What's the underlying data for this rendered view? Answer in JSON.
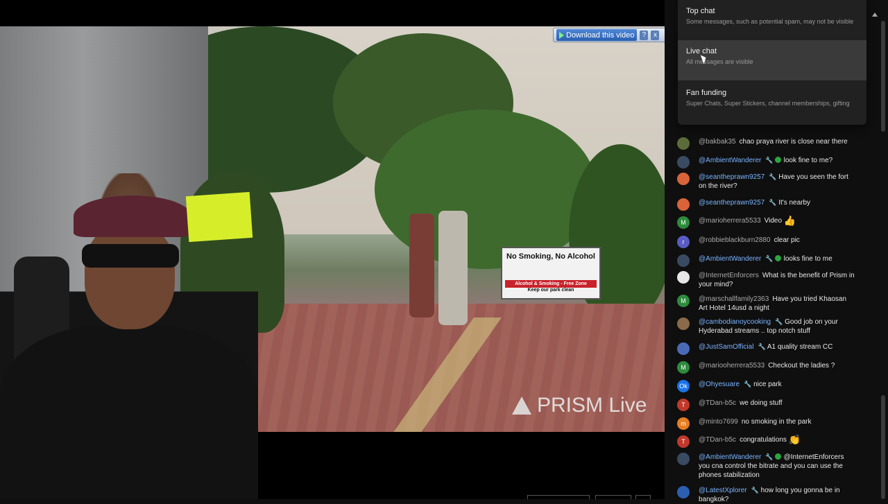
{
  "video": {
    "download_label": "Download this video",
    "help_label": "?",
    "close_label": "x",
    "sign_title": "No Smoking, No Alcohol",
    "sign_subtitle": "Alcohol & Smoking - Free Zone",
    "sign_footer": "Keep our park clean",
    "watermark": "PRISM Live"
  },
  "chat_menu": {
    "items": [
      {
        "title": "Top chat",
        "subtitle": "Some messages, such as potential spam, may not be visible"
      },
      {
        "title": "Live chat",
        "subtitle": "All messages are visible"
      },
      {
        "title": "Fan funding",
        "subtitle": "Super Chats, Super Stickers, channel memberships, gifting"
      }
    ]
  },
  "chat": {
    "messages": [
      {
        "author": "@bakbak35",
        "text": "chao praya river is close near there",
        "avatar": "",
        "avatar_color": "#5c6b3a",
        "member": false
      },
      {
        "author": "@AmbientWanderer",
        "text": "look fine to me?",
        "avatar": "",
        "avatar_color": "#394b63",
        "member": true,
        "verified": true
      },
      {
        "author": "@seantheprawn9257",
        "text": "Have you seen the fort on the river?",
        "avatar": "",
        "avatar_color": "#d9643a",
        "member": true
      },
      {
        "author": "@seantheprawn9257",
        "text": "It's nearby",
        "avatar": "",
        "avatar_color": "#d9643a",
        "member": true
      },
      {
        "author": "@marioherrera5533",
        "text": "Video",
        "avatar": "M",
        "avatar_color": "#2e8b3d",
        "member": false,
        "emoji": "👍"
      },
      {
        "author": "@robbieblackburn2880",
        "text": "clear pic",
        "avatar": "r",
        "avatar_color": "#5a5cc4",
        "member": false
      },
      {
        "author": "@AmbientWanderer",
        "text": "looks fine to me",
        "avatar": "",
        "avatar_color": "#394b63",
        "member": true,
        "verified": true
      },
      {
        "author": "@InternetEnforcers",
        "text": "What is the benefit of Prism in your mind?",
        "avatar": "",
        "avatar_color": "#e6e6e6",
        "member": false
      },
      {
        "author": "@marschallfamily2363",
        "text": "Have you tried Khaosan Art Hotel 14usd a night",
        "avatar": "M",
        "avatar_color": "#2e8b3d",
        "member": false
      },
      {
        "author": "@cambodianoycooking",
        "text": "Good job on your Hyderabad streams .. top notch stuff",
        "avatar": "",
        "avatar_color": "#8a6a4a",
        "member": true
      },
      {
        "author": "@JustSamOfficial",
        "text": "A1 quality stream CC",
        "avatar": "",
        "avatar_color": "#4a6ab8",
        "member": true
      },
      {
        "author": "@mariooherrera5533",
        "text": "Checkout the ladies ?",
        "avatar": "M",
        "avatar_color": "#2e8b3d",
        "member": false
      },
      {
        "author": "@Ohyesuare",
        "text": "nice park",
        "avatar": "Ok",
        "avatar_color": "#1a73e8",
        "member": true
      },
      {
        "author": "@TDan-b5c",
        "text": "we doing stuff",
        "avatar": "T",
        "avatar_color": "#c0392b",
        "member": false
      },
      {
        "author": "@minto7699",
        "text": "no smoking in the park",
        "avatar": "m",
        "avatar_color": "#e67e22",
        "member": false
      },
      {
        "author": "@TDan-b5c",
        "text": "congratulations",
        "avatar": "T",
        "avatar_color": "#c0392b",
        "member": false,
        "emoji": "👏"
      },
      {
        "author": "@AmbientWanderer",
        "text": "@InternetEnforcers you cna control the bitrate and you can use the phones stabilization",
        "avatar": "",
        "avatar_color": "#394b63",
        "member": true,
        "verified": true
      },
      {
        "author": "@LatestXplorer",
        "text": "how long you gonna be in bangkok?",
        "avatar": "",
        "avatar_color": "#2b5fb0",
        "member": true
      }
    ]
  },
  "colors": {
    "chat_bg": "#0f0f0f",
    "member_name": "#7ab4ff",
    "menu_bg": "#212121"
  }
}
